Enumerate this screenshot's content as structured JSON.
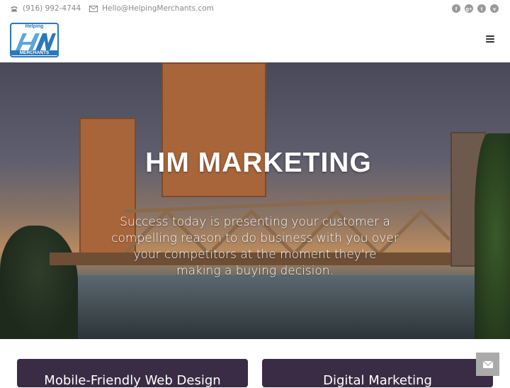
{
  "topbar": {
    "phone": "(916) 992-4744",
    "email": "Hello@HelpingMerchants.com",
    "social": [
      {
        "icon": "facebook-icon",
        "glyph": "f"
      },
      {
        "icon": "googleplus-icon",
        "glyph": "g+"
      },
      {
        "icon": "twitter-icon",
        "glyph": "t"
      },
      {
        "icon": "vimeo-icon",
        "glyph": "v"
      }
    ]
  },
  "header": {
    "logo_top": "Helping",
    "logo_bottom": "MERCHANTS",
    "logo_mark": "HM"
  },
  "hero": {
    "title": "HM MARKETING",
    "subtitle": "Success today is presenting your customer a compelling reason to do business with you over your competitors at the moment they're making a buying decision."
  },
  "cards": [
    {
      "label": "Mobile-Friendly Web Design"
    },
    {
      "label": "Digital Marketing"
    }
  ],
  "colors": {
    "brand_blue": "#2a78bd",
    "card_bg": "#3a2c44"
  }
}
